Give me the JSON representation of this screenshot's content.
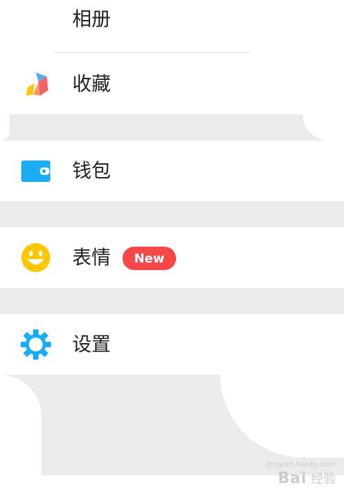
{
  "menu": {
    "partial_top_label": "相册",
    "items": [
      {
        "label": "收藏",
        "icon": "favorites-cube-icon"
      },
      {
        "label": "钱包",
        "icon": "wallet-icon"
      },
      {
        "label": "表情",
        "icon": "smiley-face-icon",
        "badge": "New"
      },
      {
        "label": "设置",
        "icon": "gear-icon"
      }
    ]
  },
  "colors": {
    "wallet_blue": "#1aadf5",
    "smiley_yellow": "#ffc700",
    "gear_blue": "#1aadf5",
    "badge_red": "#f64848",
    "separator_gray": "#ebebeb"
  },
  "watermark": {
    "brand": "Bai",
    "suffix": "经验",
    "url": "jingyan.baidu.com"
  }
}
